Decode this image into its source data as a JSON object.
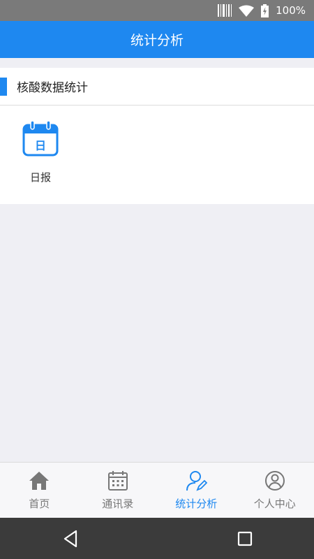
{
  "status_bar": {
    "battery_percent": "100%",
    "icons": [
      "barcode-icon",
      "wifi-icon",
      "battery-charging-icon"
    ]
  },
  "header": {
    "title": "统计分析"
  },
  "section": {
    "title": "核酸数据统计",
    "items": [
      {
        "label": "日报",
        "icon": "calendar-day-icon",
        "icon_glyph": "日"
      }
    ]
  },
  "tab_bar": {
    "tabs": [
      {
        "label": "首页",
        "icon": "home-icon"
      },
      {
        "label": "通讯录",
        "icon": "calendar-icon"
      },
      {
        "label": "统计分析",
        "icon": "user-edit-icon"
      },
      {
        "label": "个人中心",
        "icon": "account-circle-icon"
      }
    ],
    "active_index": 2
  },
  "nav_bar": {
    "buttons": [
      "back-icon",
      "recents-icon"
    ]
  },
  "colors": {
    "accent": "#1e88f0",
    "inactive": "#777777",
    "background": "#efeff4"
  }
}
